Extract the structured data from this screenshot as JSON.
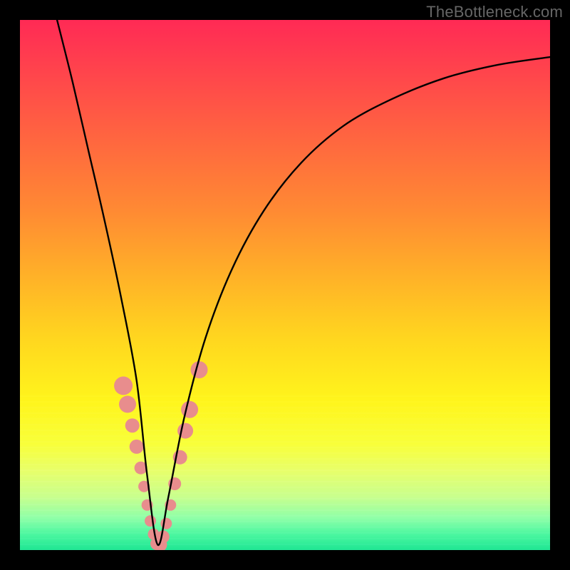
{
  "watermark": "TheBottleneck.com",
  "chart_data": {
    "type": "line",
    "title": "",
    "xlabel": "",
    "ylabel": "",
    "xlim": [
      0,
      100
    ],
    "ylim": [
      0,
      100
    ],
    "grid": false,
    "legend": false,
    "note": "V-shaped bottleneck curve: minimum near x≈26 on a green-to-red vertical gradient. No axis ticks or numeric labels are shown.",
    "series": [
      {
        "name": "bottleneck-curve",
        "x": [
          7,
          10,
          13,
          16,
          19,
          22,
          24,
          26,
          28,
          31,
          35,
          40,
          46,
          53,
          61,
          70,
          80,
          90,
          100
        ],
        "y": [
          100,
          88,
          75,
          62,
          48,
          32,
          14,
          1,
          10,
          25,
          40,
          53,
          64,
          73,
          80,
          85,
          89,
          91.5,
          93
        ]
      }
    ],
    "markers": {
      "name": "pink-dots",
      "color": "#e88d8d",
      "x": [
        19.5,
        20.3,
        21.2,
        22.0,
        22.8,
        23.4,
        24.0,
        24.6,
        25.2,
        25.8,
        26.4,
        27.0,
        27.6,
        28.4,
        29.2,
        30.2,
        31.2,
        32.0,
        33.8
      ],
      "y": [
        31.0,
        27.5,
        23.5,
        19.5,
        15.5,
        12.0,
        8.5,
        5.5,
        3.0,
        1.2,
        1.0,
        2.5,
        5.0,
        8.5,
        12.5,
        17.5,
        22.5,
        26.5,
        34.0
      ],
      "r": [
        13,
        12,
        10,
        10,
        9,
        8,
        8,
        8,
        8,
        9,
        10,
        9,
        8,
        8,
        9,
        10,
        11,
        12,
        12
      ]
    },
    "colors": {
      "curve": "#000000",
      "curve_right_segment": "#1b1230",
      "marker": "#e88d8d",
      "gradient_top": "#ff2a55",
      "gradient_mid": "#ffd61f",
      "gradient_bottom": "#1fe693",
      "frame": "#000000"
    }
  }
}
